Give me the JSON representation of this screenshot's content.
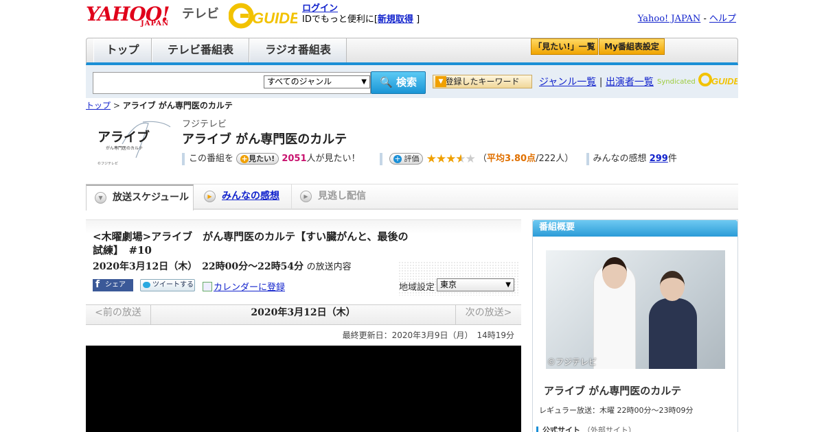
{
  "header": {
    "yahoo_logo_text": "YAHOO!",
    "yahoo_japan_text": "JAPAN",
    "tv_label": "テレビ",
    "gguide_logo_text": "G GUIDE",
    "login_link": "ログイン",
    "login_prefix": "IDでもっと便利に[",
    "signup_link": "新規取得",
    "login_suffix": "]",
    "yahoo_japan_link": "Yahoo! JAPAN",
    "separator": " - ",
    "help_link": "ヘルプ"
  },
  "nav": {
    "tabs": [
      "トップ",
      "テレビ番組表",
      "ラジオ番組表"
    ],
    "mitai_list_btn": "「見たい!」一覧",
    "my_schedule_btn": "My番組表設定"
  },
  "search": {
    "genre_select": "すべてのジャンル",
    "search_button": "検索",
    "keyword_button": "登録したキーワード",
    "genre_list_link": "ジャンル一覧",
    "link_separator": "|",
    "performer_list_link": "出演者一覧",
    "syndicated_label": "Syndicated"
  },
  "breadcrumb": {
    "top_link": "トップ",
    "separator": ">",
    "current": "アライブ がん専門医のカルテ"
  },
  "program": {
    "logo_text": "アライブ",
    "logo_sub": "がん専門医のカルテ",
    "logo_credit": "©フジテレビ",
    "station": "フジテレビ",
    "title": "アライブ がん専門医のカルテ",
    "mitai_prefix": "この番組を",
    "mitai_button": "見たい!",
    "mitai_count": "2051",
    "mitai_suffix": "人が見たい！",
    "rate_button": "評価",
    "rating": 3.8,
    "rating_open": "（",
    "avg_label": "平均3.80点",
    "rating_count": "/222人）",
    "kansou_label": "みんなの感想",
    "kansou_count": "299",
    "kansou_unit": "件"
  },
  "tabs": {
    "schedule": "放送スケジュール",
    "kansou": "みんなの感想",
    "minogashi": "見逃し配信"
  },
  "episode": {
    "title": "<木曜劇場>アライブ　がん専門医のカルテ【すい臓がんと、最後の試練】　#10",
    "date": "2020年3月12日（木）　22時00分～22時54分",
    "date_suffix": "の放送内容",
    "share_facebook": "シェア",
    "share_twitter": "ツイートする",
    "calendar_link": "カレンダーに登録",
    "region_label": "地域設定",
    "region_value": "東京",
    "prev_label": "<前の放送",
    "current_date": "2020年3月12日（木）",
    "next_label": "次の放送>",
    "last_updated": "最終更新日：2020年3月9日（月）　14時19分"
  },
  "sidebar": {
    "heading": "番組概要",
    "photo_credit": "©フジテレビ",
    "title": "アライブ がん専門医のカルテ",
    "regular": "レギュラー放送：木曜 22時00分～23時09分",
    "official_site": "公式サイト",
    "official_note": "（外部サイト）"
  },
  "colors": {
    "accent_blue": "#1a8fd6",
    "yahoo_red": "#e0001a",
    "highlight_pink": "#c8126e",
    "star_orange": "#f0a000"
  }
}
